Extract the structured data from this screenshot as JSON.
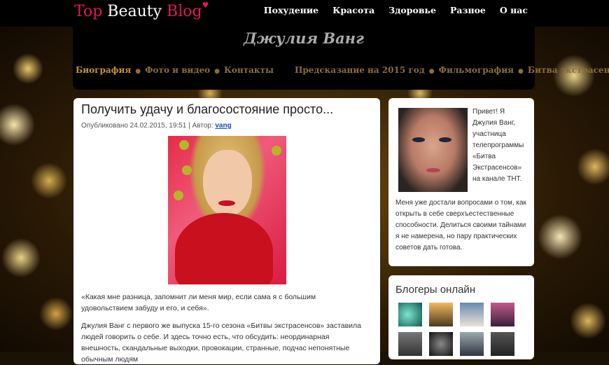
{
  "topbar": {
    "logo_a": "Top",
    "logo_b": "Beauty",
    "logo_c": "Blog",
    "nav": [
      "Похудение",
      "Красота",
      "Здоровье",
      "Разное",
      "О нас"
    ]
  },
  "header": {
    "site_title": "Джулия Ванг",
    "subnav": [
      "Биография",
      "Фото и видео",
      "Контакты",
      "Предсказание на 2015 год",
      "Фильмография",
      "Битва экстрасенсов"
    ]
  },
  "post": {
    "title": "Получить удачу и благосостояние просто...",
    "meta_prefix": "Опубликовано 24.02.2015, 19:51 | Автор: ",
    "author": "vang",
    "para1": "«Какая мне разница, запомнит ли меня мир, если сама я с большим удовольствием забуду и его, и себя».",
    "para2": "Джулия Ванг с первого же выпуска 15-го сезона «Битвы экстрасенсов» заставила людей говорить о себе. И здесь точно есть, что обсудить: неординарная внешность, скандальные выходки, провокации, странные, подчас непонятные обычным людям"
  },
  "sidebar": {
    "intro": "Привет! Я Джулия Ванг, участница телепрограммы «Битва Экстрасенсов» на канале ТНТ.",
    "body": "Меня уже достали вопросами о том, как открыть в себе сверхъестественные способности. Делиться своими тайнами я не намерена, но пару практических советов дать готова.",
    "bloggers_title": "Блогеры онлайн"
  },
  "colors": {
    "accent_pink": "#e4165e",
    "link_blue": "#1d43c8",
    "subnav_active": "#c8913a"
  }
}
